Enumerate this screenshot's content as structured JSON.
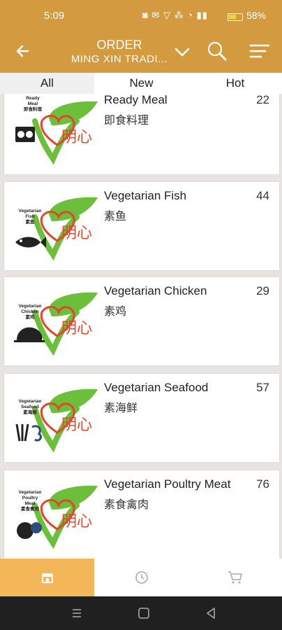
{
  "status": {
    "time": "5:09",
    "icons": "◙ ✉ ▽ ⁂ ◔ ▮▮",
    "battery_percent": "58%",
    "battery_level": 0.58
  },
  "appbar": {
    "title": "ORDER",
    "subtitle": "MING XIN TRADI...",
    "back_icon": "arrow-left-icon",
    "dropdown_icon": "chevron-down-icon",
    "search_icon": "search-icon",
    "menu_icon": "menu-icon"
  },
  "tabs": [
    {
      "label": "All",
      "selected": true
    },
    {
      "label": "New",
      "selected": false
    },
    {
      "label": "Hot",
      "selected": false
    }
  ],
  "categories": [
    {
      "name": "Ready Meal",
      "chinese": "即食料理",
      "count": "22",
      "logo_label": "Ready\nMeal\n即食料理",
      "icon": "stove-icon"
    },
    {
      "name": "Vegetarian Fish",
      "chinese": "素鱼",
      "count": "44",
      "logo_label": "Vegetarian\nFish\n素鱼",
      "icon": "fish-icon"
    },
    {
      "name": "Vegetarian Chicken",
      "chinese": "素鸡",
      "count": "29",
      "logo_label": "Vegetarian\nChicken\n素鸡",
      "icon": "chicken-icon"
    },
    {
      "name": "Vegetarian Seafood",
      "chinese": "素海鲜",
      "count": "57",
      "logo_label": "Vegetarian\nSeafood\n素海鲜",
      "icon": "seafood-icon"
    },
    {
      "name": "Vegetarian Poultry Meat",
      "chinese": "素食禽肉",
      "count": "76",
      "logo_label": "Vegetarian\nPoultry\nMeat\n素食禽肉",
      "icon": "poultry-icon"
    }
  ],
  "brand": {
    "logo_text": "明心",
    "accent": "#d39a3f",
    "leaf_green": "#6cbf3a",
    "logo_red": "#e2462e"
  },
  "bottom_nav": [
    {
      "icon": "store-icon",
      "active": true
    },
    {
      "icon": "clock-icon",
      "active": false
    },
    {
      "icon": "cart-icon",
      "active": false
    }
  ],
  "system_nav": [
    "recent-apps-icon",
    "home-icon",
    "back-icon"
  ]
}
